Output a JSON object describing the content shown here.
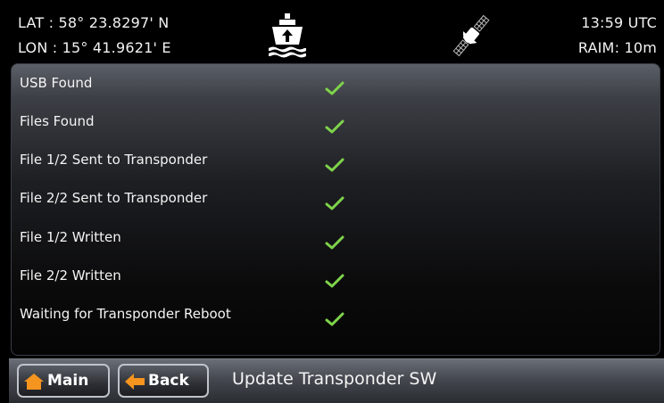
{
  "header": {
    "lat": "LAT  : 58° 23.8297' N",
    "lon": "LON : 15° 41.9621' E",
    "time": "13:59 UTC",
    "raim": "RAIM: 10m",
    "ship_icon": "ship-icon",
    "satellite_icon": "satellite-icon"
  },
  "status": {
    "check_color": "#7fd44a",
    "items": [
      {
        "label": "USB Found",
        "icon": "check-icon"
      },
      {
        "label": "Files Found",
        "icon": "check-icon"
      },
      {
        "label": "File 1/2 Sent to Transponder",
        "icon": "check-icon"
      },
      {
        "label": "File 2/2 Sent to Transponder",
        "icon": "check-icon"
      },
      {
        "label": "File 1/2 Written",
        "icon": "check-icon"
      },
      {
        "label": "File 2/2 Written",
        "icon": "check-icon"
      },
      {
        "label": "Waiting for Transponder Reboot",
        "icon": "check-icon"
      }
    ]
  },
  "footer": {
    "main_label": "Main",
    "back_label": "Back",
    "title": "Update Transponder SW",
    "accent_color": "#f5941f"
  }
}
